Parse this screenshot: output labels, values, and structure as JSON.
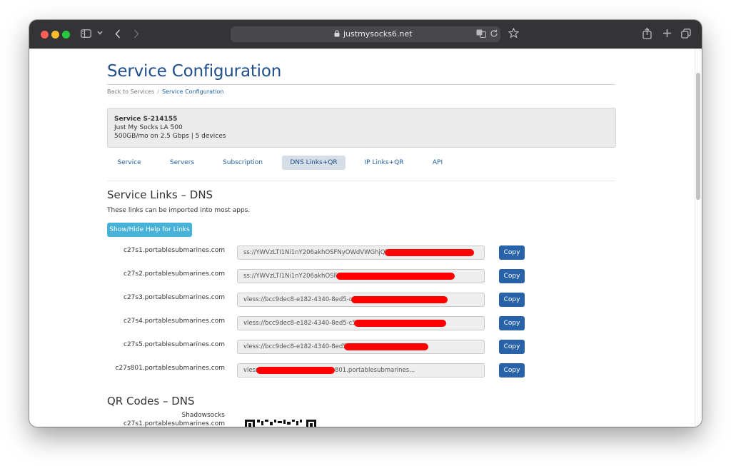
{
  "browser": {
    "url": "justmysocks6.net",
    "icons": [
      "sidebar-icon",
      "chevron-down-icon",
      "back-icon",
      "forward-icon",
      "lock-icon",
      "translate-icon",
      "reload-icon",
      "bookmark-star-icon",
      "share-icon",
      "new-tab-icon",
      "tabs-overview-icon"
    ]
  },
  "page": {
    "title": "Service Configuration",
    "breadcrumb": {
      "back": "Back to Services",
      "separator": "/",
      "current": "Service Configuration"
    }
  },
  "service": {
    "id_line": "Service S-214155",
    "plan": "Just My Socks LA 500",
    "details": "500GB/mo on 2.5 Gbps | 5 devices"
  },
  "tabs": [
    {
      "label": "Service",
      "active": false
    },
    {
      "label": "Servers",
      "active": false
    },
    {
      "label": "Subscription",
      "active": false
    },
    {
      "label": "DNS Links+QR",
      "active": true
    },
    {
      "label": "IP Links+QR",
      "active": false
    },
    {
      "label": "API",
      "active": false
    }
  ],
  "links_section": {
    "title": "Service Links – DNS",
    "description": "These links can be imported into most apps.",
    "help_button": "Show/Hide Help for Links",
    "copy_label": "Copy",
    "rows": [
      {
        "host": "c27s1.portablesubmarines.com",
        "value": "ss://YWVzLTI1Ni1nY206akhOSFNyOWdVWGhjQk2"
      },
      {
        "host": "c27s2.portablesubmarines.com",
        "value": "ss://YWVzLTI1Ni1nY206akhOSFN                                  WJsZXN..."
      },
      {
        "host": "c27s3.portablesubmarines.com",
        "value": "vless://bcc9dec8-e182-4340-8ed5-c55                           marines.c..."
      },
      {
        "host": "c27s4.portablesubmarines.com",
        "value": "vless://bcc9dec8-e182-4340-8ed5-c55b                          marines.c..."
      },
      {
        "host": "c27s5.portablesubmarines.com",
        "value": "vless://bcc9dec8-e182-4340-8ed5-c                          lesubmarines.c..."
      },
      {
        "host": "c27s801.portablesubmarines.com",
        "value": "vless                            d5-c55b9f874a7d@c27s801.portablesubmarines..."
      }
    ]
  },
  "qr_section": {
    "title": "QR Codes – DNS",
    "first_label_type": "Shadowsocks",
    "first_label_host": "c27s1.portablesubmarines.com"
  },
  "colors": {
    "title_blue": "#1f4e8a",
    "copy_button": "#2862a8",
    "help_button": "#47b2d8",
    "redaction": "#ff0000",
    "toolbar": "#343437"
  }
}
